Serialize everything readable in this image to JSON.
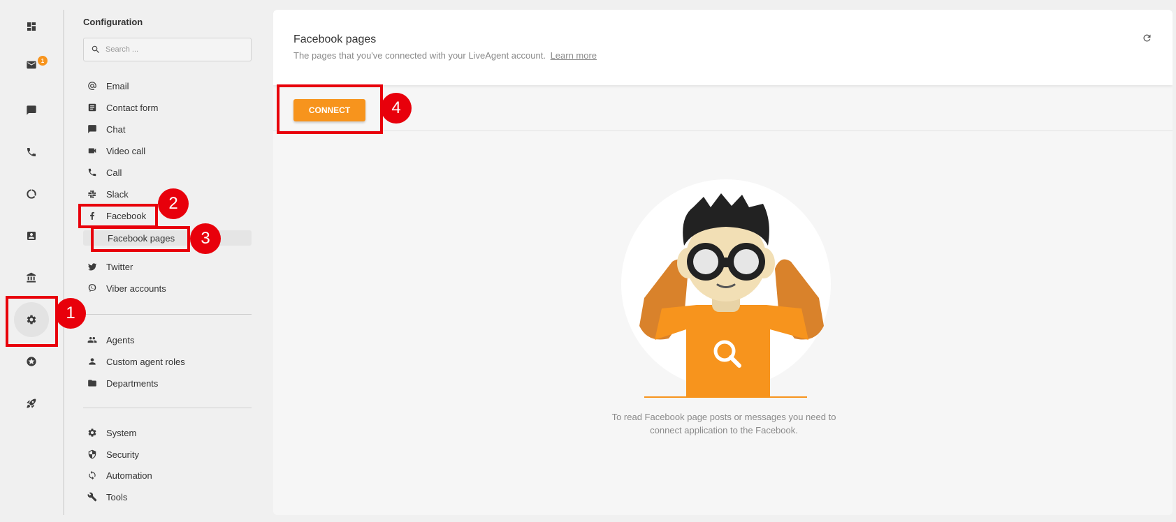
{
  "rail": {
    "items": [
      {
        "icon": "dashboard-icon"
      },
      {
        "icon": "mail-icon",
        "badge": "1"
      },
      {
        "icon": "chat-icon"
      },
      {
        "icon": "phone-icon"
      },
      {
        "icon": "reports-icon"
      },
      {
        "icon": "contacts-icon"
      },
      {
        "icon": "knowledgebase-icon"
      },
      {
        "icon": "gear-icon",
        "active": true
      },
      {
        "icon": "star-icon"
      },
      {
        "icon": "rocket-icon"
      }
    ]
  },
  "menu": {
    "title": "Configuration",
    "search_placeholder": "Search ...",
    "items": [
      {
        "label": "Email",
        "icon": "at-icon"
      },
      {
        "label": "Contact form",
        "icon": "form-icon"
      },
      {
        "label": "Chat",
        "icon": "chat-icon"
      },
      {
        "label": "Video call",
        "icon": "video-icon"
      },
      {
        "label": "Call",
        "icon": "phone-icon"
      },
      {
        "label": "Slack",
        "icon": "slack-icon"
      },
      {
        "label": "Facebook",
        "icon": "facebook-icon"
      },
      {
        "label": "Facebook pages",
        "selected": true
      },
      {
        "label": "Twitter",
        "icon": "twitter-icon"
      },
      {
        "label": "Viber accounts",
        "icon": "viber-icon"
      },
      {
        "label": "Agents",
        "icon": "agents-icon"
      },
      {
        "label": "Custom agent roles",
        "icon": "person-icon"
      },
      {
        "label": "Departments",
        "icon": "folder-icon"
      },
      {
        "label": "System",
        "icon": "gear-icon"
      },
      {
        "label": "Security",
        "icon": "shield-icon"
      },
      {
        "label": "Automation",
        "icon": "sync-icon"
      },
      {
        "label": "Tools",
        "icon": "wrench-icon"
      }
    ]
  },
  "main": {
    "title": "Facebook pages",
    "subtitle": "The pages that you've connected with your LiveAgent account.",
    "learn_more": "Learn more",
    "connect_label": "CONNECT",
    "empty_text": "To read Facebook page posts or messages you need to connect application to the Facebook."
  },
  "annotations": [
    "1",
    "2",
    "3",
    "4"
  ],
  "colors": {
    "accent": "#f7941d",
    "annotation": "#e8000b"
  }
}
